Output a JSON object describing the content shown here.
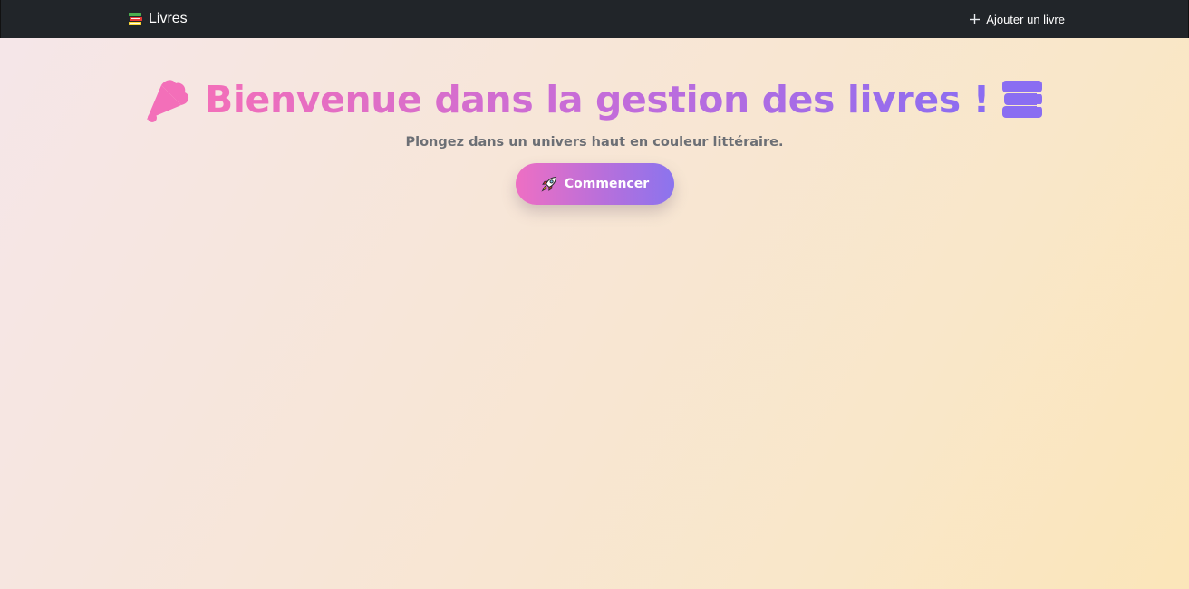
{
  "navbar": {
    "brand_label": "Livres",
    "brand_icon": "books-icon",
    "add_label": "Ajouter un livre",
    "add_icon": "plus-icon",
    "background": "#212529"
  },
  "hero": {
    "title": "Bienvenue dans la gestion des livres !",
    "title_icons": [
      "party-popper-icon",
      "books-icon"
    ],
    "gradient_colors": [
      "#f36fb9",
      "#c56cd9",
      "#8a6df2"
    ],
    "tagline": "Plongez dans un univers haut en couleur littéraire.",
    "cta_label": "Commencer",
    "cta_icon": "rocket-icon"
  }
}
